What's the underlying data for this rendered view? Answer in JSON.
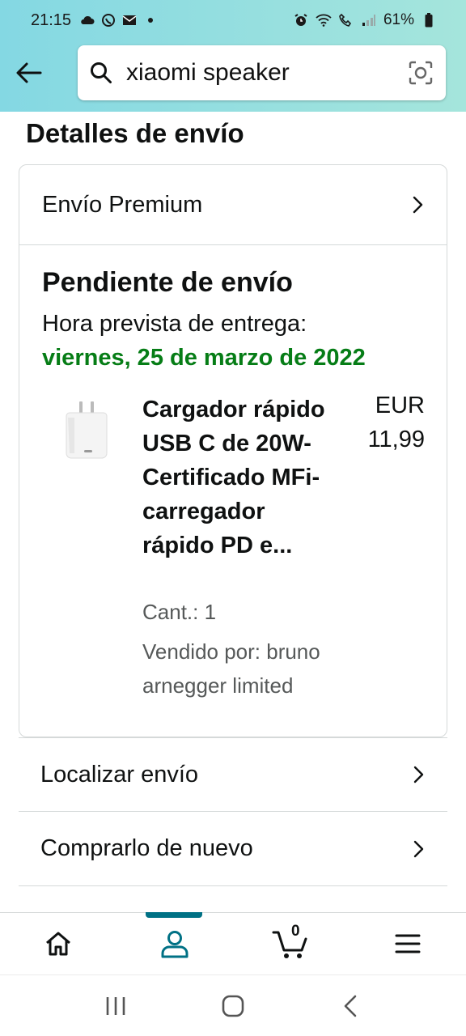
{
  "status_bar": {
    "time": "21:15",
    "battery_percent": "61%",
    "left_icons": [
      "cloud-icon",
      "whatsapp-icon",
      "mail-icon",
      "dot-icon"
    ],
    "right_icons": [
      "alarm-icon",
      "wifi-icon",
      "call-icon",
      "signal-icon",
      "battery-icon"
    ]
  },
  "search": {
    "query": "xiaomi speaker"
  },
  "section_title": "Detalles de envío",
  "shipping_card": {
    "shipping_type": "Envío Premium",
    "status": "Pendiente de envío",
    "eta_label": "Hora prevista de entrega:",
    "eta_date": "viernes, 25 de marzo de 2022",
    "product": {
      "title": "Cargador rápido USB C de 20W-Certificado MFi-carregador rápido PD e...",
      "currency": "EUR",
      "price": "11,99",
      "quantity": "Cant.: 1",
      "seller": "Vendido por: bruno arnegger limited"
    }
  },
  "actions": [
    {
      "label": "Localizar envío"
    },
    {
      "label": "Comprarlo de nuevo"
    }
  ],
  "bottom_nav": {
    "items": [
      "home-icon",
      "account-icon",
      "cart-icon",
      "menu-icon"
    ],
    "cart_count": "0",
    "active": "account"
  },
  "colors": {
    "header_gradient_start": "#84d8e3",
    "header_gradient_end": "#a5e5dc",
    "eta_green": "#067d16",
    "active_teal": "#007185"
  }
}
